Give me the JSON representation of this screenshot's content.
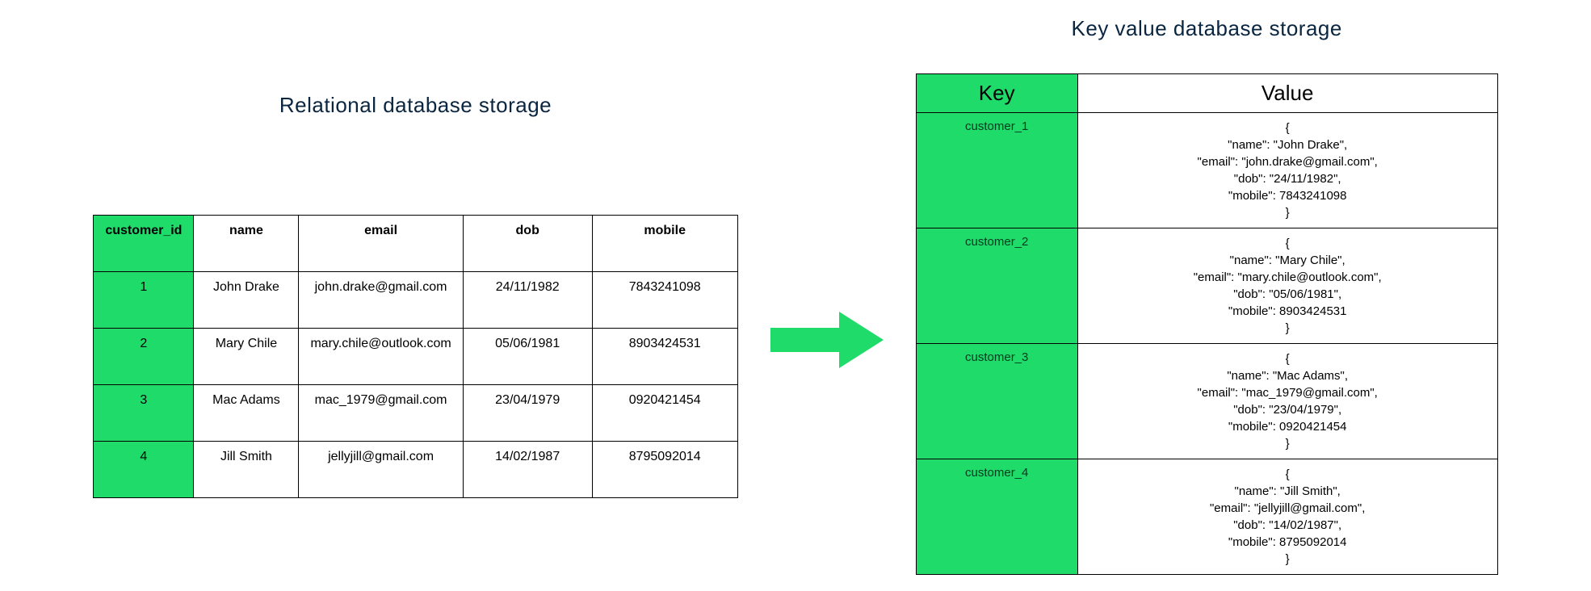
{
  "titles": {
    "relational": "Relational database storage",
    "kv": "Key value database storage"
  },
  "relational": {
    "headers": {
      "customer_id": "customer_id",
      "name": "name",
      "email": "email",
      "dob": "dob",
      "mobile": "mobile"
    },
    "rows": [
      {
        "customer_id": "1",
        "name": "John Drake",
        "email": "john.drake@gmail.com",
        "dob": "24/11/1982",
        "mobile": "7843241098"
      },
      {
        "customer_id": "2",
        "name": "Mary Chile",
        "email": "mary.chile@outlook.com",
        "dob": "05/06/1981",
        "mobile": "8903424531"
      },
      {
        "customer_id": "3",
        "name": "Mac Adams",
        "email": "mac_1979@gmail.com",
        "dob": "23/04/1979",
        "mobile": "0920421454"
      },
      {
        "customer_id": "4",
        "name": "Jill Smith",
        "email": "jellyjill@gmail.com",
        "dob": "14/02/1987",
        "mobile": "8795092014"
      }
    ]
  },
  "kv": {
    "headers": {
      "key": "Key",
      "value": "Value"
    },
    "rows": [
      {
        "key": "customer_1",
        "value": "{\n\"name\": \"John Drake\",\n\"email\": \"john.drake@gmail.com\",\n\"dob\": \"24/11/1982\",\n\"mobile\": 7843241098\n}"
      },
      {
        "key": "customer_2",
        "value": "{\n\"name\": \"Mary Chile\",\n\"email\": \"mary.chile@outlook.com\",\n\"dob\": \"05/06/1981\",\n\"mobile\": 8903424531\n}"
      },
      {
        "key": "customer_3",
        "value": "{\n\"name\": \"Mac Adams\",\n\"email\": \"mac_1979@gmail.com\",\n\"dob\": \"23/04/1979\",\n\"mobile\": 0920421454\n}"
      },
      {
        "key": "customer_4",
        "value": "{\n\"name\": \"Jill Smith\",\n\"email\": \"jellyjill@gmail.com\",\n\"dob\": \"14/02/1987\",\n\"mobile\": 8795092014\n}"
      }
    ]
  },
  "colors": {
    "accent": "#1fdb6a"
  }
}
